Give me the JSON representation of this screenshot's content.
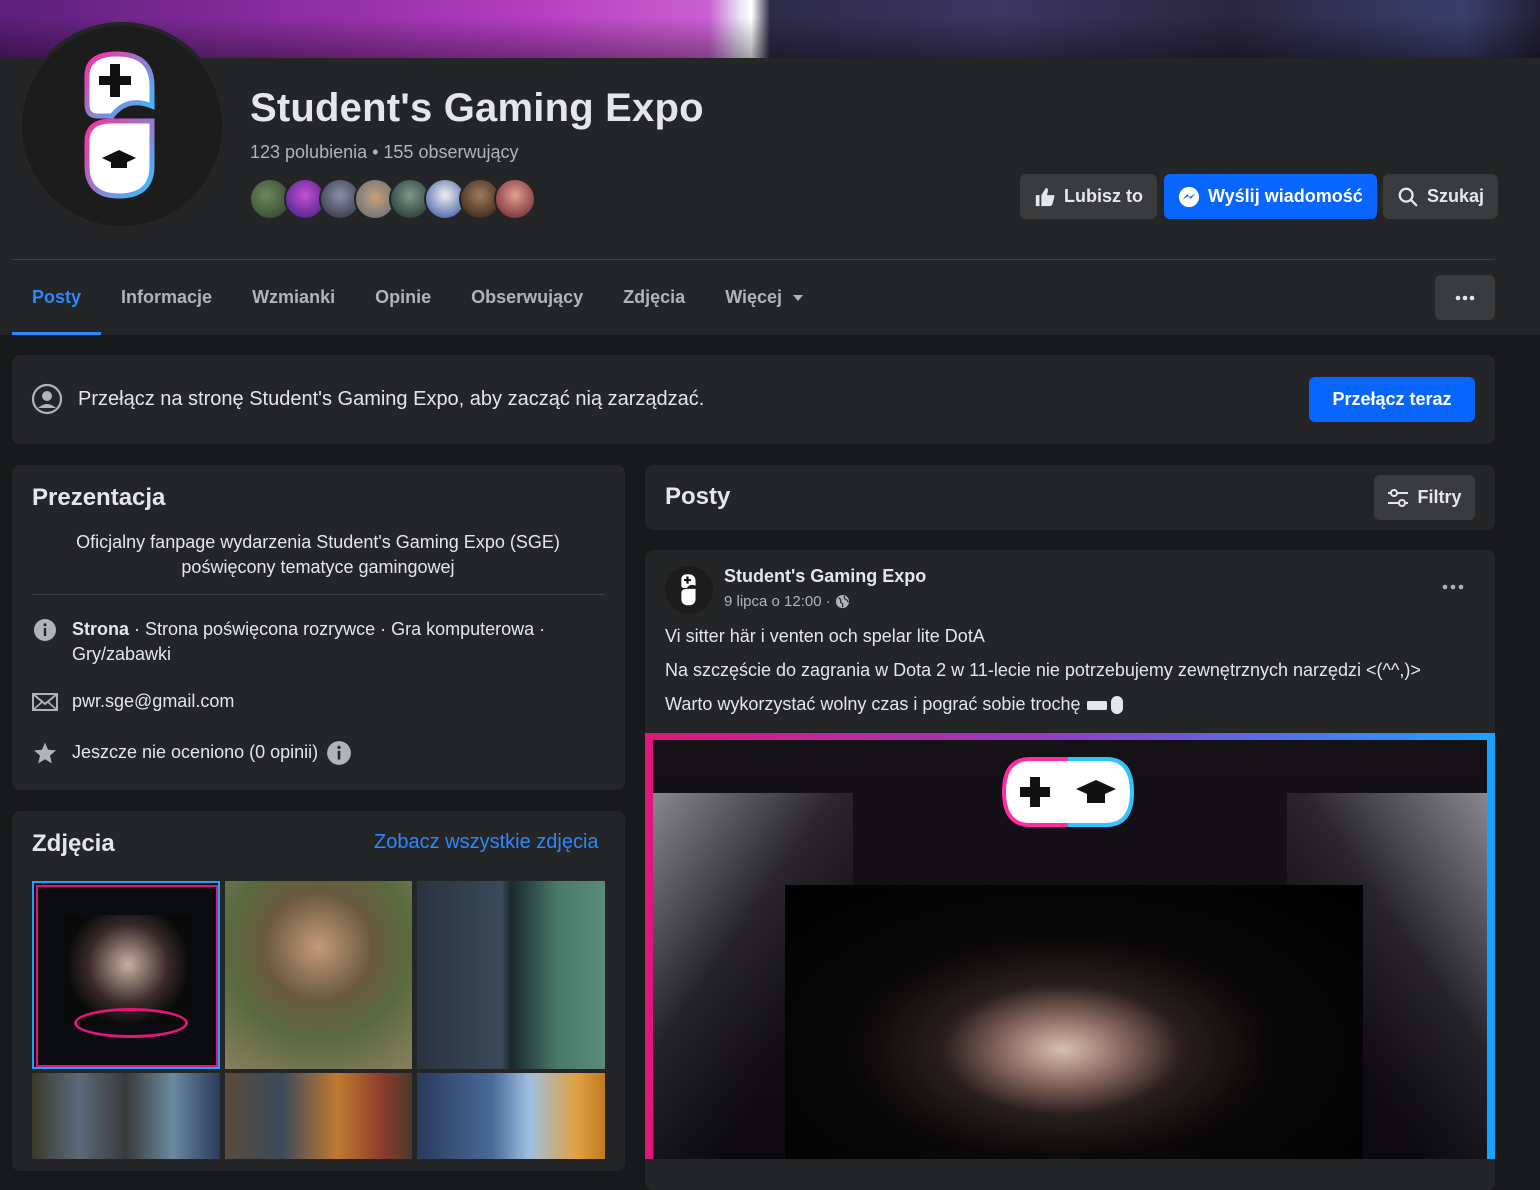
{
  "colors": {
    "accent": "#2d88ff",
    "primary_button": "#0866ff",
    "background": "#18191a",
    "card": "#242526"
  },
  "header": {
    "title": "Student's Gaming Expo",
    "stats": "123 polubienia • 155 obserwujący",
    "actions": {
      "like": "Lubisz to",
      "message": "Wyślij wiadomość",
      "search": "Szukaj"
    }
  },
  "tabs": [
    {
      "label": "Posty",
      "active": true
    },
    {
      "label": "Informacje"
    },
    {
      "label": "Wzmianki"
    },
    {
      "label": "Opinie"
    },
    {
      "label": "Obserwujący"
    },
    {
      "label": "Zdjęcia"
    },
    {
      "label": "Więcej",
      "has_dropdown": true
    }
  ],
  "switch_banner": {
    "text": "Przełącz na stronę Student's Gaming Expo, aby zacząć nią zarządzać.",
    "button": "Przełącz teraz"
  },
  "intro": {
    "title": "Prezentacja",
    "description": "Oficjalny fanpage wydarzenia Student's Gaming Expo (SGE) poświęcony tematyce gamingowej",
    "category_label": "Strona",
    "category_text": " · Strona poświęcona rozrywce · Gra komputerowa · Gry/zabawki",
    "email": "pwr.sge@gmail.com",
    "rating": "Jeszcze nie oceniono (0 opinii)"
  },
  "photos": {
    "title": "Zdjęcia",
    "see_all": "Zobacz wszystkie zdjęcia"
  },
  "posts": {
    "title": "Posty",
    "filters": "Filtry",
    "post": {
      "author": "Student's Gaming Expo",
      "meta": "9 lipca o 12:00 ·",
      "lines": [
        "Vi sitter här i venten och spelar lite DotA",
        "Na szczęście do zagrania w Dota 2 w 11-lecie nie potrzebujemy zewnętrznych narzędzi <(^^,)>",
        "Warto wykorzystać wolny czas i pograć sobie trochę"
      ]
    }
  }
}
